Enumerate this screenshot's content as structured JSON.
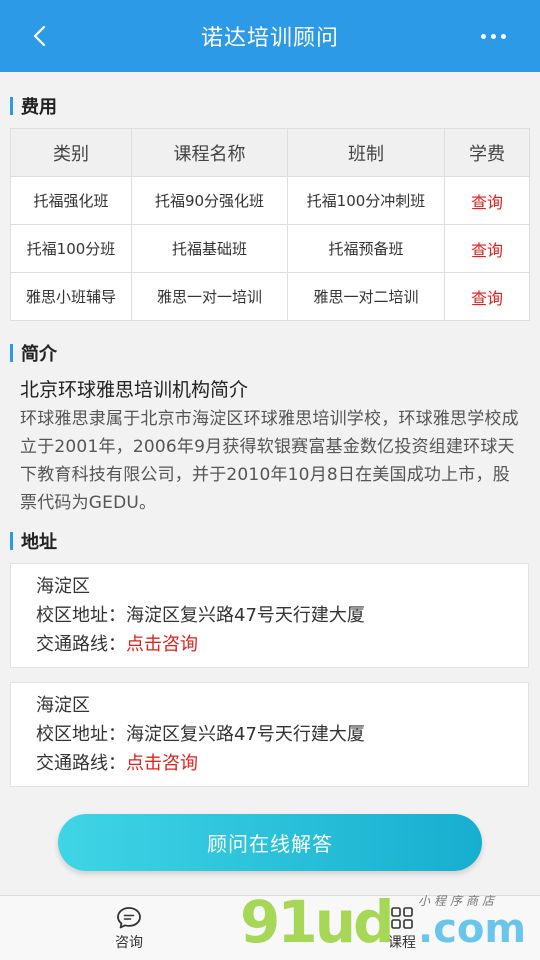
{
  "header": {
    "title": "诺达培训顾问"
  },
  "fees": {
    "section_title": "费用",
    "columns": [
      "类别",
      "课程名称",
      "班制",
      "学费"
    ],
    "rows": [
      [
        "托福强化班",
        "托福90分强化班",
        "托福100分冲刺班",
        "查询"
      ],
      [
        "托福100分班",
        "托福基础班",
        "托福预备班",
        "查询"
      ],
      [
        "雅思小班辅导",
        "雅思一对一培训",
        "雅思一对二培训",
        "查询"
      ]
    ]
  },
  "intro": {
    "section_title": "简介",
    "subtitle": "北京环球雅思培训机构简介",
    "body": "环球雅思隶属于北京市海淀区环球雅思培训学校，环球雅思学校成立于2001年，2006年9月获得软银赛富基金数亿投资组建环球天下教育科技有限公司，并于2010年10月8日在美国成功上市，股票代码为GEDU。"
  },
  "address": {
    "section_title": "地址",
    "cards": [
      {
        "district": "海淀区",
        "campus_label": "校区地址：",
        "campus_value": "海淀区复兴路47号天行建大厦",
        "route_label": "交通路线：",
        "route_link": "点击咨询"
      },
      {
        "district": "海淀区",
        "campus_label": "校区地址：",
        "campus_value": "海淀区复兴路47号天行建大厦",
        "route_label": "交通路线：",
        "route_link": "点击咨询"
      }
    ]
  },
  "consult_button": "顾问在线解答",
  "tabbar": {
    "consult": "咨询",
    "course": "课程"
  },
  "watermark": {
    "main": "91ud",
    "com": ".com",
    "sub": "小程序商店"
  },
  "colors": {
    "header": "#2d9ae8",
    "link": "#e0221c",
    "button_start": "#3fd5e6",
    "button_end": "#17aed0"
  }
}
